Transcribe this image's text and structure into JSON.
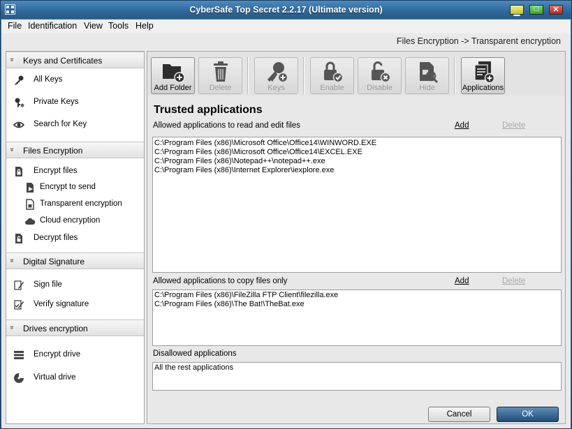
{
  "window": {
    "title": "CyberSafe Top Secret 2.2.17 (Ultimate version)",
    "controls": {
      "minimize": "▁",
      "maximize": "□",
      "close": "✕"
    }
  },
  "menu": [
    "File",
    "Identification",
    "View",
    "Tools",
    "Help"
  ],
  "breadcrumb": "Files Encryption -> Transparent encryption",
  "sidebar": {
    "sections": [
      {
        "title": "Keys and Certificates",
        "chevron": "»",
        "items": [
          {
            "label": "All Keys",
            "icon": "key-icon"
          },
          {
            "label": "Private Keys",
            "icon": "private-key-icon"
          },
          {
            "label": "Search for Key",
            "icon": "search-key-icon"
          }
        ]
      },
      {
        "title": "Files Encryption",
        "chevron": "»",
        "items": [
          {
            "label": "Encrypt files",
            "icon": "lock-file-icon"
          },
          {
            "label": "Encrypt to send",
            "icon": "send-file-icon"
          },
          {
            "label": "Transparent encryption",
            "icon": "transparent-file-icon"
          },
          {
            "label": "Cloud encryption",
            "icon": "cloud-icon"
          },
          {
            "label": "Decrypt files",
            "icon": "unlock-file-icon"
          }
        ]
      },
      {
        "title": "Digital Signature",
        "chevron": "»",
        "items": [
          {
            "label": "Sign file",
            "icon": "pen-icon"
          },
          {
            "label": "Verify signature",
            "icon": "check-pen-icon"
          }
        ]
      },
      {
        "title": "Drives encryption",
        "chevron": "»",
        "items": [
          {
            "label": "Encrypt drive",
            "icon": "drive-icon"
          },
          {
            "label": "Virtual drive",
            "icon": "virtual-drive-icon"
          }
        ]
      }
    ]
  },
  "toolbar": {
    "add_folder": "Add Folder",
    "delete": "Delete",
    "keys": "Keys",
    "enable": "Enable",
    "disable": "Disable",
    "hide": "Hide",
    "applications": "Applications"
  },
  "content": {
    "title": "Trusted applications",
    "read_edit": {
      "label": "Allowed applications to read and edit files",
      "add": "Add",
      "delete": "Delete",
      "items": [
        "C:\\Program Files (x86)\\Microsoft Office\\Office14\\WINWORD.EXE",
        "C:\\Program Files (x86)\\Microsoft Office\\Office14\\EXCEL.EXE",
        "C:\\Program Files (x86)\\Notepad++\\notepad++.exe",
        "C:\\Program Files (x86)\\Internet Explorer\\iexplore.exe"
      ]
    },
    "copy_only": {
      "label": "Allowed applications to copy files only",
      "add": "Add",
      "delete": "Delete",
      "items": [
        "C:\\Program Files (x86)\\FileZilla FTP Client\\filezilla.exe",
        "C:\\Program Files (x86)\\The Bat!\\TheBat.exe"
      ]
    },
    "disallowed": {
      "label": "Disallowed applications",
      "items": [
        "All the rest applications"
      ]
    }
  },
  "footer": {
    "cancel": "Cancel",
    "ok": "OK"
  },
  "colors": {
    "titlebar": "#2f6798",
    "ok_button": "#1f4d78",
    "panel": "#e8e8e8",
    "disabled_text": "#9a9a9a"
  }
}
